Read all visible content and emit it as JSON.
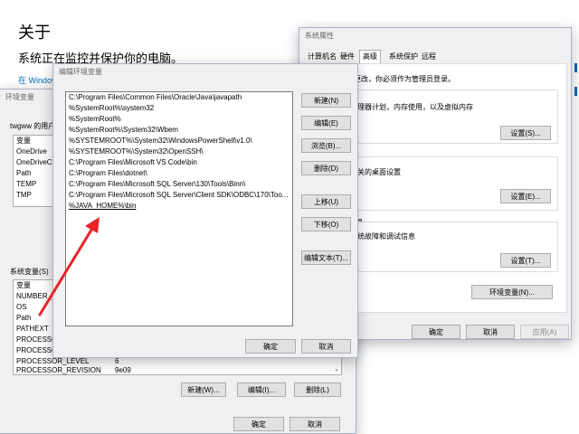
{
  "settings": {
    "title": "关于",
    "subtitle": "系统正在监控并保护你的电脑。",
    "link": "在 Window"
  },
  "env_vars": {
    "title": "环境变量",
    "user_label": "twgww 的用户",
    "user_header": "变量",
    "user_vars": [
      "OneDrive",
      "OneDriveCo",
      "Path",
      "TEMP",
      "TMP"
    ],
    "sys_label": "系统变量(S)",
    "sys_header": "变量",
    "sys_vars": [
      {
        "name": "NUMBER_O",
        "value": ""
      },
      {
        "name": "OS",
        "value": ""
      },
      {
        "name": "Path",
        "value": ""
      },
      {
        "name": "PATHEXT",
        "value": ""
      },
      {
        "name": "PROCESSOR",
        "value": ""
      },
      {
        "name": "PROCESSOR",
        "value": ""
      },
      {
        "name": "PROCESSOR_LEVEL",
        "value": "6"
      },
      {
        "name": "PROCESSOR_REVISION",
        "value": "9e09"
      }
    ],
    "new_label": "新建(W)...",
    "edit_label": "编辑(I)...",
    "delete_label": "删除(L)",
    "ok_label": "确定",
    "cancel_label": "取消"
  },
  "sys_props": {
    "title": "系统属性",
    "tabs": [
      "计算机名",
      "硬件",
      "高级",
      "系统保护",
      "远程"
    ],
    "active_tab": "高级",
    "admin_note": "更改，你必须作为管理员登录。",
    "perf_desc": "理器计划，内存使用，以及虚拟内存",
    "profile_desc": "关的桌面设置",
    "startup_head": "复",
    "startup_desc": "统故障和调试信息",
    "settings_label": "设置(S)...",
    "settings2_label": "设置(E)...",
    "settings3_label": "设置(T)...",
    "envvar_label": "环境变量(N)...",
    "ok_label": "确定",
    "cancel_label": "取消",
    "apply_label": "应用(A)"
  },
  "edit_env": {
    "title": "编辑环境变量",
    "paths": [
      "C:\\Program Files\\Common Files\\Oracle\\Java\\javapath",
      "%SystemRoot%\\system32",
      "%SystemRoot%",
      "%SystemRoot%\\System32\\Wbem",
      "%SYSTEMROOT%\\System32\\WindowsPowerShell\\v1.0\\",
      "%SYSTEMROOT%\\System32\\OpenSSH\\",
      "C:\\Program Files\\Microsoft VS Code\\bin",
      "C:\\Program Files\\dotnet\\",
      "C:\\Program Files\\Microsoft SQL Server\\130\\Tools\\Binn\\",
      "C:\\Program Files\\Microsoft SQL Server\\Client SDK\\ODBC\\170\\Too...",
      "%JAVA_HOME%\\bin"
    ],
    "new_label": "新建(N)",
    "edit_label": "编辑(E)",
    "browse_label": "浏览(B)...",
    "delete_label": "删除(D)",
    "up_label": "上移(U)",
    "down_label": "下移(O)",
    "edit_text_label": "编辑文本(T)...",
    "ok_label": "确定",
    "cancel_label": "取消"
  },
  "colors": {
    "accent": "#0078d7",
    "arrow": "#e8232a"
  }
}
